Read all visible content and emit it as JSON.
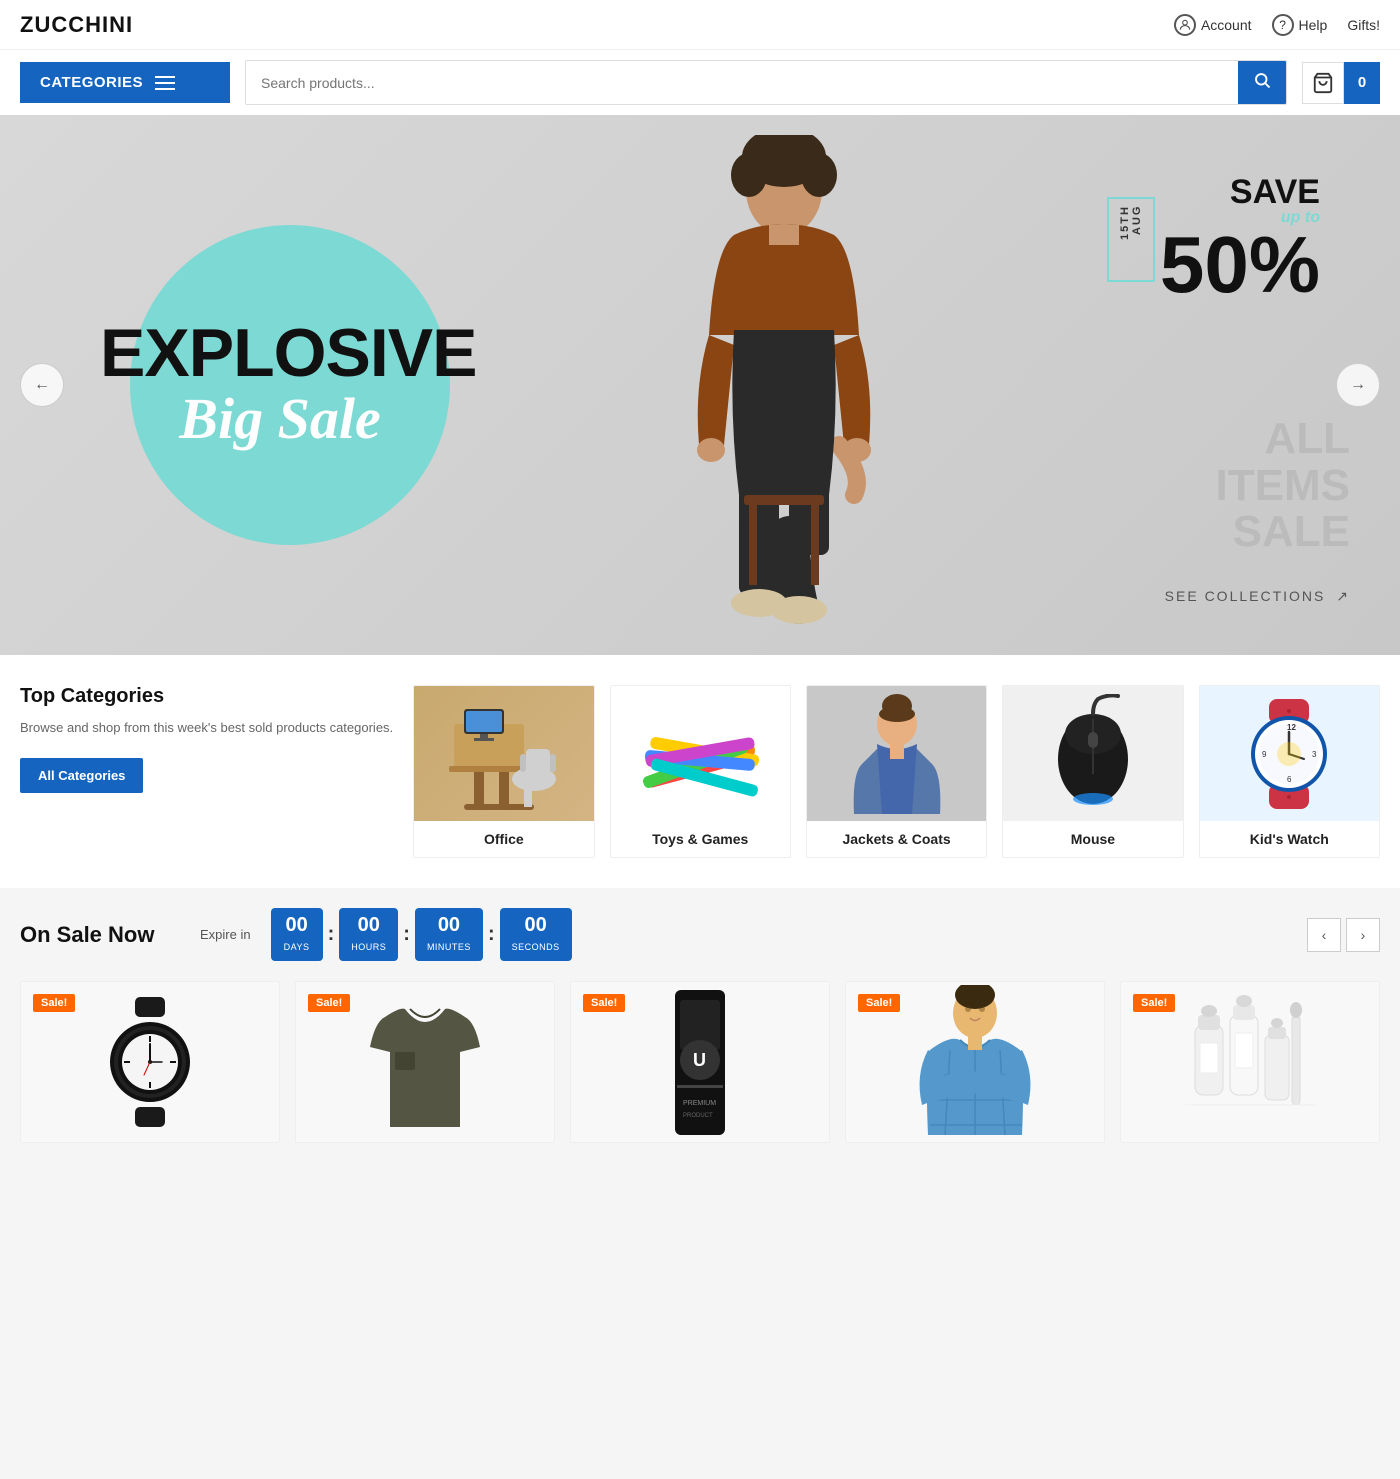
{
  "header": {
    "logo": "ZUCCHINI",
    "account_label": "Account",
    "help_label": "Help",
    "gifts_label": "Gifts!"
  },
  "navbar": {
    "categories_label": "CATEGORIES",
    "search_placeholder": "Search products...",
    "cart_count": "0"
  },
  "hero": {
    "line1": "EXPLOSIVE",
    "line2": "Big Sale",
    "date_badge": "15TH AUG",
    "save_title": "SAVE",
    "save_upto": "up to",
    "save_percent": "50%",
    "all_items": "ALL\nITEMS\nSALE",
    "see_collections": "SEE COLLECTIONS",
    "prev_label": "←",
    "next_label": "→"
  },
  "top_categories": {
    "title": "Top Categories",
    "description": "Browse and shop from this week's best sold products categories.",
    "all_button": "All Categories",
    "categories": [
      {
        "label": "Office",
        "color": "#c8b080"
      },
      {
        "label": "Toys & Games",
        "color": "#fff"
      },
      {
        "label": "Jackets & Coats",
        "color": "#b0b0b0"
      },
      {
        "label": "Mouse",
        "color": "#e0e0e0"
      },
      {
        "label": "Kid's Watch",
        "color": "#d0e8ff"
      }
    ]
  },
  "on_sale": {
    "title": "On Sale Now",
    "expire_label": "Expire in",
    "timer": {
      "days": "00",
      "hours": "00",
      "minutes": "00",
      "seconds": "00",
      "days_label": "DAYS",
      "hours_label": "HOURS",
      "minutes_label": "MINUTES",
      "seconds_label": "SECONDS"
    },
    "products": [
      {
        "badge": "Sale!",
        "name": "Watch"
      },
      {
        "badge": "Sale!",
        "name": "T-Shirt"
      },
      {
        "badge": "Sale!",
        "name": "Coffee Product"
      },
      {
        "badge": "Sale!",
        "name": "Shirt"
      },
      {
        "badge": "Sale!",
        "name": "Baby Bottles"
      }
    ]
  }
}
